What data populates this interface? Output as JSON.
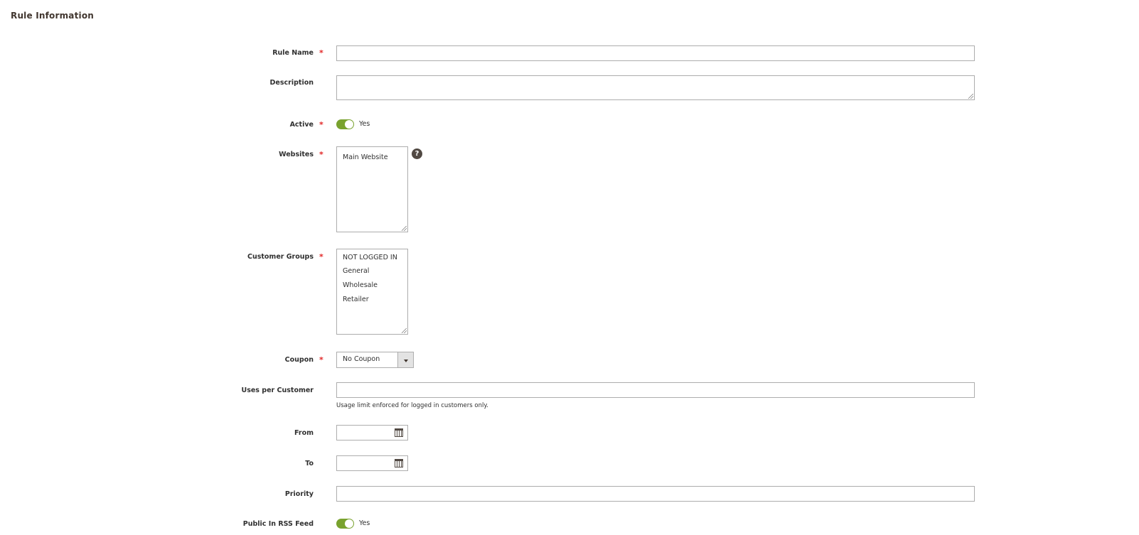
{
  "section": {
    "title": "Rule Information"
  },
  "fields": {
    "rule_name": {
      "label": "Rule Name",
      "value": ""
    },
    "description": {
      "label": "Description",
      "value": ""
    },
    "active": {
      "label": "Active",
      "state": "Yes"
    },
    "websites": {
      "label": "Websites",
      "options": [
        "Main Website"
      ]
    },
    "customer_groups": {
      "label": "Customer Groups",
      "options": [
        "NOT LOGGED IN",
        "General",
        "Wholesale",
        "Retailer"
      ]
    },
    "coupon": {
      "label": "Coupon",
      "selected": "No Coupon"
    },
    "uses_per_customer": {
      "label": "Uses per Customer",
      "value": "",
      "note": "Usage limit enforced for logged in customers only."
    },
    "from": {
      "label": "From",
      "value": ""
    },
    "to": {
      "label": "To",
      "value": ""
    },
    "priority": {
      "label": "Priority",
      "value": ""
    },
    "public_rss": {
      "label": "Public In RSS Feed",
      "state": "Yes"
    }
  },
  "required_marker": "*",
  "help_icon_glyph": "?",
  "colors": {
    "toggle_on": "#79a22e",
    "required": "#e22626",
    "help_icon_bg": "#514943"
  }
}
